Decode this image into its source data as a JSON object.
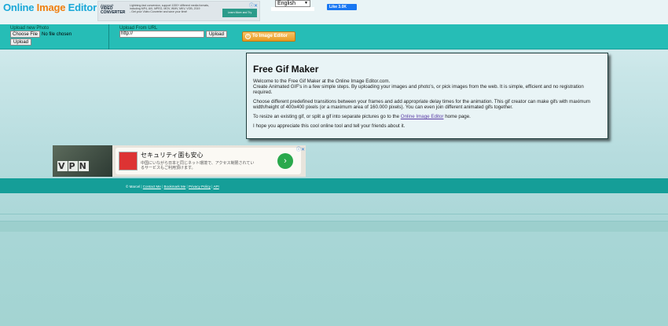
{
  "header": {
    "logo_part1": "Online",
    "logo_part2": "Image",
    "logo_part3": "Editor",
    "language": "English",
    "fb_like": "Like 3.0K"
  },
  "ad_top": {
    "brand_small": "Aiseesoft",
    "brand": "VIDEO CONVERTER",
    "text": "Lightning-fast conversion, support 1000+ different media formats, including MP4, AVI, MPEG, MOV, WMV, MKV, VOB, 2019",
    "text2": "- Get your Video Converter and save your time!",
    "button": "Learn More and Try"
  },
  "toolbar": {
    "upload_new_label": "Upload new Photo",
    "choose_file": "Choose File",
    "no_file": "No file chosen",
    "upload_button": "Upload",
    "upload_url_label": "Upload From URL",
    "url_value": "http://",
    "url_upload_button": "Upload",
    "to_editor_button": "To Image Editor"
  },
  "info": {
    "title": "Free Gif Maker",
    "p1_line1": "Welcome to the Free Gif Maker at the Online Image Editor.com.",
    "p1_line2": "Create Animated GIF's in a few simple steps. By uploading your images and photo's, or pick images from the web. It is simple, efficient and no registration required.",
    "p2": "Choose different predefined transitions between your frames and add appropriate delay times for the animation. This gif creator can make gifs with maximum width/height of 400x400 pixels (or a maximum area of 160.000 pixels). You can even join different animated gifs together.",
    "p3_before": "To resize an existing gif, or split a gif into separate pictures go to the ",
    "p3_link": "Online Image Editor",
    "p3_after": " home page.",
    "p4": "I hope you appreciate this cool online tool and tell your friends about it."
  },
  "ad_banner": {
    "title": "セキュリティ面も安心",
    "text": "中国にいながら日本と同じネット環境で、アクセス制限されているサービスもご利用頂けます。",
    "arrow": "›"
  },
  "footer": {
    "copyright": "© Marcel",
    "links": [
      "Contact Me",
      "Bookmark Me",
      "Privacy Policy",
      "API"
    ]
  },
  "colors": {
    "toolbar": "#26bdb6",
    "footer": "#159e98",
    "logo_blue": "#1aa8d8",
    "logo_orange": "#f07f10"
  }
}
